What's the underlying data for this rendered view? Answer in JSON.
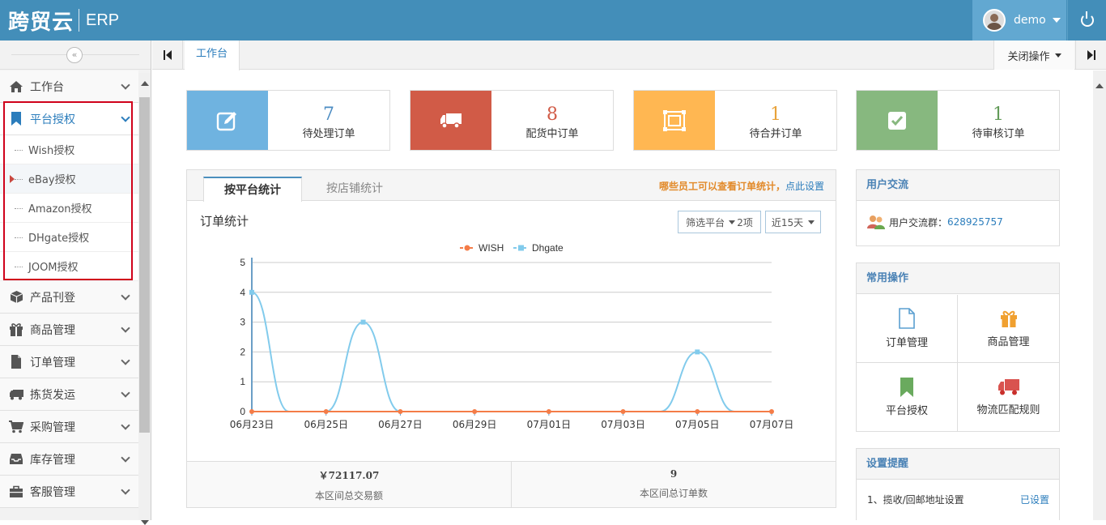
{
  "header": {
    "logo_main": "跨贸云",
    "logo_sub": "ERP",
    "user_name": "demo"
  },
  "sidebar": {
    "collapse_glyph": "«",
    "items": [
      {
        "label": "工作台",
        "icon": "home-icon"
      },
      {
        "label": "平台授权",
        "icon": "bookmark-icon",
        "active": true,
        "children": [
          "Wish授权",
          "eBay授权",
          "Amazon授权",
          "DHgate授权",
          "JOOM授权"
        ],
        "current_child": "eBay授权"
      },
      {
        "label": "产品刊登",
        "icon": "cube-icon"
      },
      {
        "label": "商品管理",
        "icon": "gift-icon"
      },
      {
        "label": "订单管理",
        "icon": "file-icon"
      },
      {
        "label": "拣货发运",
        "icon": "truck-icon"
      },
      {
        "label": "采购管理",
        "icon": "cart-icon"
      },
      {
        "label": "库存管理",
        "icon": "inbox-icon"
      },
      {
        "label": "客服管理",
        "icon": "briefcase-icon"
      }
    ]
  },
  "tabs": {
    "active": "工作台",
    "close_ops": "关闭操作"
  },
  "stats": [
    {
      "value": "7",
      "label": "待处理订单",
      "color": "#6fb3e0",
      "num_color": "#4a8bc2",
      "icon": "edit-icon"
    },
    {
      "value": "8",
      "label": "配货中订单",
      "color": "#d15b47",
      "num_color": "#d15b47",
      "icon": "truck-icon"
    },
    {
      "value": "1",
      "label": "待合并订单",
      "color": "#ffb752",
      "num_color": "#e8a23a",
      "icon": "merge-icon"
    },
    {
      "value": "1",
      "label": "待审核订单",
      "color": "#87b87f",
      "num_color": "#629b58",
      "icon": "check-icon"
    }
  ],
  "chart_panel": {
    "tab_on": "按平台统计",
    "tab_off": "按店铺统计",
    "notice": "哪些员工可以查看订单统计，",
    "notice_link": "点此设置",
    "title": "订单统计",
    "filter_label": "筛选平台",
    "filter_count": "2项",
    "range_label": "近15天",
    "total_amount": "￥72117.07",
    "total_amount_label": "本区间总交易额",
    "total_orders": "9",
    "total_orders_label": "本区间总订单数"
  },
  "chart_data": {
    "type": "line",
    "x": [
      "06月23日",
      "06月24日",
      "06月25日",
      "06月26日",
      "06月27日",
      "06月28日",
      "06月29日",
      "06月30日",
      "07月01日",
      "07月02日",
      "07月03日",
      "07月04日",
      "07月05日",
      "07月06日",
      "07月07日"
    ],
    "x_tick_labels": [
      "06月23日",
      "06月25日",
      "06月27日",
      "06月29日",
      "07月01日",
      "07月03日",
      "07月05日",
      "07月07日"
    ],
    "series": [
      {
        "name": "WISH",
        "color": "#f47c48",
        "values": [
          0,
          0,
          0,
          0,
          0,
          0,
          0,
          0,
          0,
          0,
          0,
          0,
          0,
          0,
          0
        ]
      },
      {
        "name": "Dhgate",
        "color": "#82cbec",
        "values": [
          4,
          0,
          0,
          3,
          0,
          0,
          0,
          0,
          0,
          0,
          0,
          0,
          2,
          0,
          0
        ]
      }
    ],
    "ylim": [
      0,
      5
    ],
    "y_ticks": [
      0,
      1,
      2,
      3,
      4,
      5
    ],
    "grid": true,
    "legend": "top-center"
  },
  "community": {
    "title": "用户交流",
    "label": "用户交流群：",
    "group_id": "628925757"
  },
  "common_ops": {
    "title": "常用操作",
    "items": [
      {
        "label": "订单管理",
        "icon": "file-icon"
      },
      {
        "label": "商品管理",
        "icon": "gift-icon"
      },
      {
        "label": "平台授权",
        "icon": "bookmark-icon"
      },
      {
        "label": "物流匹配规则",
        "icon": "truck-icon"
      }
    ]
  },
  "reminders": {
    "title": "设置提醒",
    "items": [
      {
        "label": "1、揽收/回邮地址设置",
        "status": "已设置"
      }
    ]
  }
}
